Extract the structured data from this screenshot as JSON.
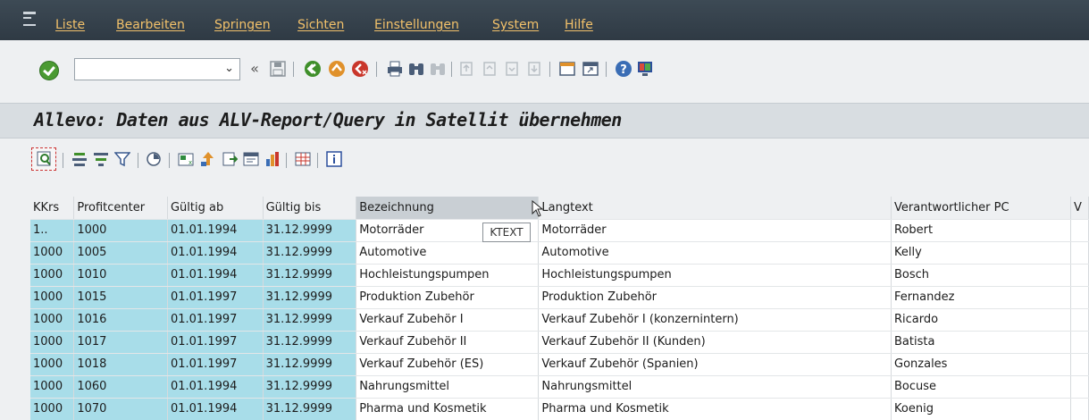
{
  "menu": {
    "items": [
      "Liste",
      "Bearbeiten",
      "Springen",
      "Sichten",
      "Einstellungen",
      "System",
      "Hilfe"
    ]
  },
  "toolbar": {
    "command_value": "",
    "back_glyph": "«",
    "dropdown_glyph": "⌄"
  },
  "title": "Allevo: Daten aus ALV-Report/Query in Satellit übernehmen",
  "grid": {
    "columns": [
      "KKrs",
      "Profitcenter",
      "Gültig ab",
      "Gültig bis",
      "Bezeichnung",
      "Langtext",
      "Verantwortlicher PC",
      "V"
    ],
    "rows": [
      [
        "1..",
        "1000",
        "01.01.1994",
        "31.12.9999",
        "Motorräder",
        "Motorräder",
        "Robert"
      ],
      [
        "1000",
        "1005",
        "01.01.1994",
        "31.12.9999",
        "Automotive",
        "Automotive",
        "Kelly"
      ],
      [
        "1000",
        "1010",
        "01.01.1994",
        "31.12.9999",
        "Hochleistungspumpen",
        "Hochleistungspumpen",
        "Bosch"
      ],
      [
        "1000",
        "1015",
        "01.01.1997",
        "31.12.9999",
        "Produktion Zubehör",
        "Produktion Zubehör",
        "Fernandez"
      ],
      [
        "1000",
        "1016",
        "01.01.1997",
        "31.12.9999",
        "Verkauf Zubehör I",
        "Verkauf Zubehör I (konzernintern)",
        "Ricardo"
      ],
      [
        "1000",
        "1017",
        "01.01.1997",
        "31.12.9999",
        "Verkauf Zubehör II",
        "Verkauf Zubehör II (Kunden)",
        "Batista"
      ],
      [
        "1000",
        "1018",
        "01.01.1997",
        "31.12.9999",
        "Verkauf Zubehör (ES)",
        "Verkauf Zubehör (Spanien)",
        "Gonzales"
      ],
      [
        "1000",
        "1060",
        "01.01.1994",
        "31.12.9999",
        "Nahrungsmittel",
        "Nahrungsmittel",
        "Bocuse"
      ],
      [
        "1000",
        "1070",
        "01.01.1994",
        "31.12.9999",
        "Pharma und Kosmetik",
        "Pharma und Kosmetik",
        "Koenig"
      ]
    ]
  },
  "tooltip": "KTEXT",
  "colors": {
    "menubar": "#2f3a44",
    "menu_text": "#f2c16a",
    "key_cell": "#a8dde9",
    "sorted_header": "#c9cfd4"
  }
}
